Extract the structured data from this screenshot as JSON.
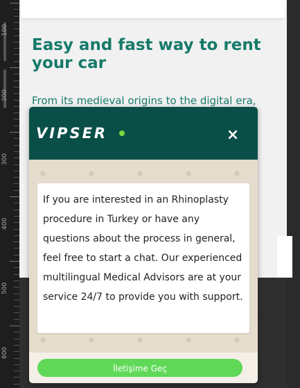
{
  "ruler": {
    "labels": [
      "100",
      "200",
      "300",
      "400",
      "500",
      "600"
    ]
  },
  "page": {
    "hero_title": "Easy and fast way to rent your car",
    "hero_text": "From its medieval origins to the digital era,"
  },
  "chat": {
    "logo": "VIPSER",
    "close_icon": "×",
    "message": "If you are interested in an Rhinoplasty procedure in Turkey or have any questions about the process in general, feel free to start a chat. Our experienced multilingual Medical Advisors are at your service 24/7 to provide you with support.",
    "contact_button": "İletişime Geç"
  },
  "colors": {
    "brand_dark": "#0a4f47",
    "accent_green": "#5fd957",
    "logo_dot": "#7bd93f",
    "hero_text": "#167a6a"
  }
}
